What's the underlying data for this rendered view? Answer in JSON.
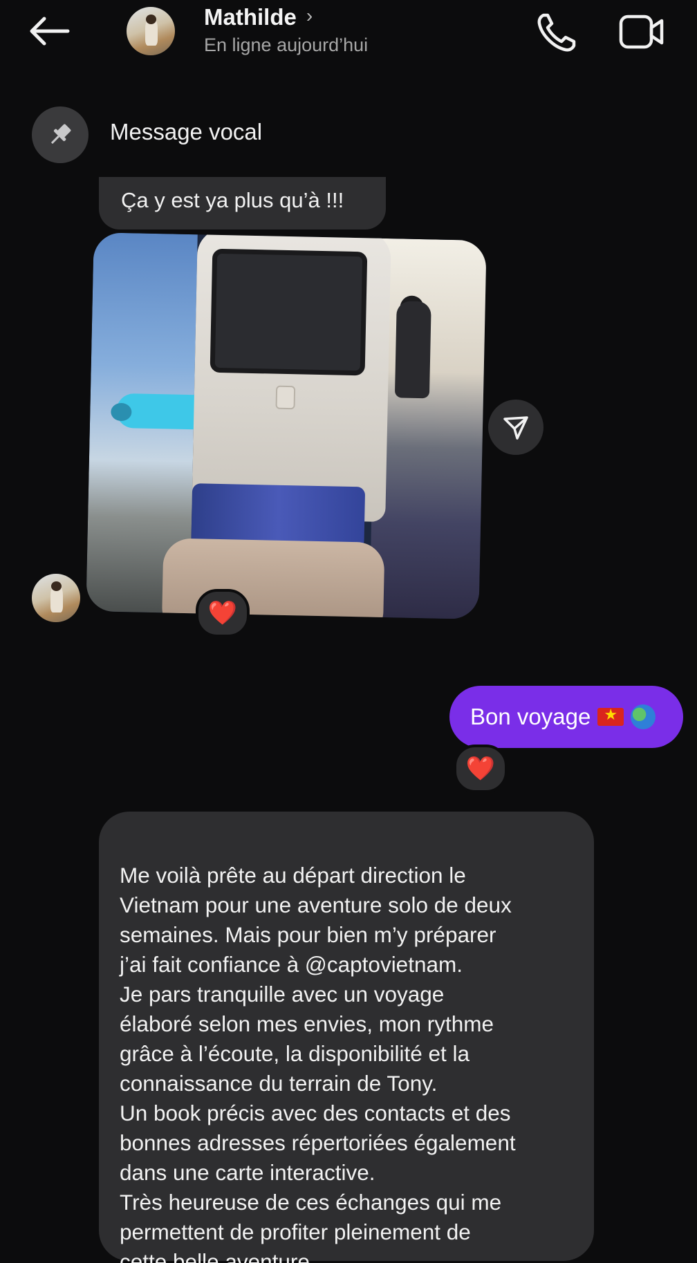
{
  "header": {
    "contact_name": "Mathilde",
    "chevron": "›",
    "status": "En ligne aujourd’hui",
    "icons": [
      "back-arrow-icon",
      "phone-icon",
      "video-camera-icon"
    ]
  },
  "pinned": {
    "label": "Message vocal",
    "icon": "pin-icon"
  },
  "messages": [
    {
      "type": "received-text",
      "text": "Ça y est ya plus qu’à !!!"
    },
    {
      "type": "received-photo",
      "reaction": "❤️",
      "description_icon": "share-icon"
    },
    {
      "type": "sent-text",
      "text": "Bon voyage",
      "emojis": [
        "vietnam-flag",
        "globe-emoji"
      ],
      "reaction": "❤️"
    },
    {
      "type": "received-text",
      "text": "Me voilà prête au départ direction le\nVietnam pour une aventure solo de deux\nsemaines. Mais pour bien m’y préparer\nj’ai fait confiance à @captovietnam.\nJe pars tranquille avec un voyage\nélaboré selon mes envies, mon rythme\ngrâce à l’écoute, la disponibilité et la\nconnaissance du terrain de Tony.\nUn book précis avec des contacts et des\nbonnes adresses répertoriées également\ndans une carte interactive.\nTrès heureuse de ces échanges qui me\npermettent de profiter pleinement de\ncette belle aventure."
    }
  ],
  "colors": {
    "background": "#0c0c0d",
    "received_bubble": "#2e2e30",
    "sent_bubble": "#7a2ee8",
    "secondary_text": "#a7a7a7"
  }
}
